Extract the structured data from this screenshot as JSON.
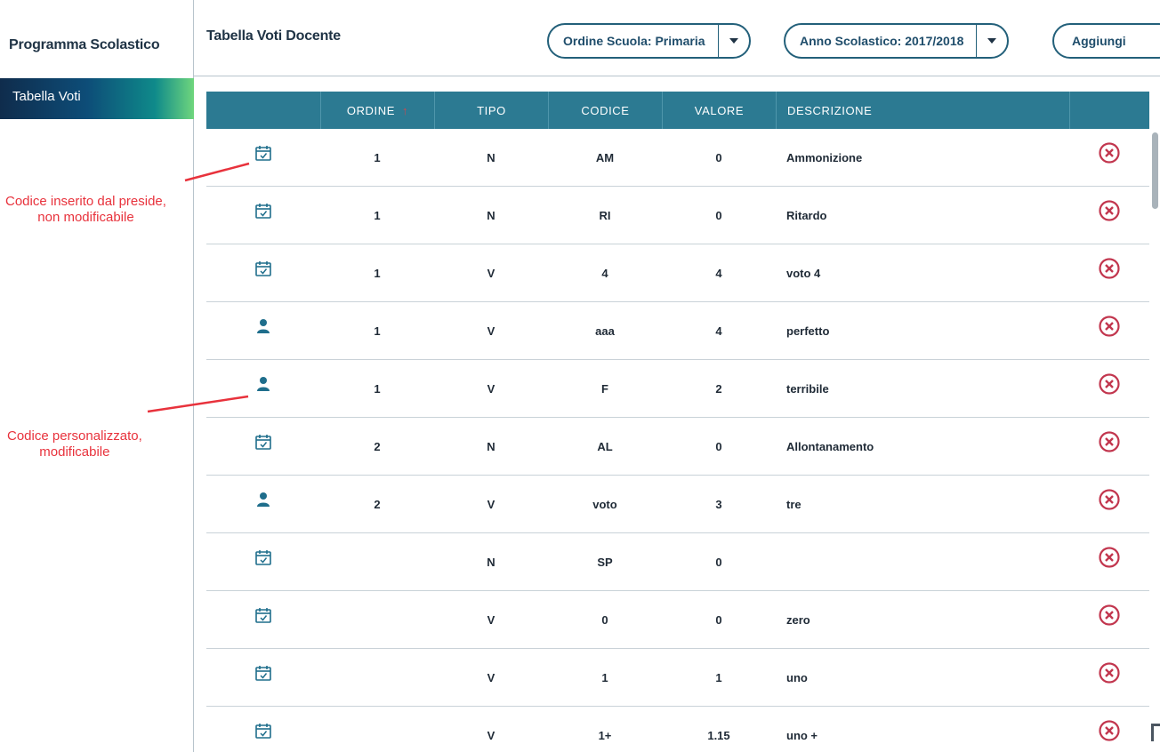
{
  "sidebar": {
    "title": "Programma Scolastico",
    "items": [
      {
        "label": "Tabella Voti"
      }
    ]
  },
  "header": {
    "title": "Tabella Voti Docente",
    "order_select": "Ordine Scuola: Primaria",
    "year_select": "Anno Scolastico: 2017/2018",
    "add_label": "Aggiungi"
  },
  "table": {
    "columns": [
      "",
      "ORDINE",
      "TIPO",
      "CODICE",
      "VALORE",
      "DESCRIZIONE",
      ""
    ],
    "sort_indicator": "↑",
    "rows": [
      {
        "icon": "calendar-check-icon",
        "ordine": "1",
        "tipo": "N",
        "codice": "AM",
        "valore": "0",
        "descrizione": "Ammonizione"
      },
      {
        "icon": "calendar-check-icon",
        "ordine": "1",
        "tipo": "N",
        "codice": "RI",
        "valore": "0",
        "descrizione": "Ritardo"
      },
      {
        "icon": "calendar-check-icon",
        "ordine": "1",
        "tipo": "V",
        "codice": "4",
        "valore": "4",
        "descrizione": "voto 4"
      },
      {
        "icon": "user-icon",
        "ordine": "1",
        "tipo": "V",
        "codice": "aaa",
        "valore": "4",
        "descrizione": "perfetto"
      },
      {
        "icon": "user-icon",
        "ordine": "1",
        "tipo": "V",
        "codice": "F",
        "valore": "2",
        "descrizione": "terribile"
      },
      {
        "icon": "calendar-check-icon",
        "ordine": "2",
        "tipo": "N",
        "codice": "AL",
        "valore": "0",
        "descrizione": "Allontanamento"
      },
      {
        "icon": "user-icon",
        "ordine": "2",
        "tipo": "V",
        "codice": "voto",
        "valore": "3",
        "descrizione": "tre"
      },
      {
        "icon": "calendar-check-icon",
        "ordine": "",
        "tipo": "N",
        "codice": "SP",
        "valore": "0",
        "descrizione": ""
      },
      {
        "icon": "calendar-check-icon",
        "ordine": "",
        "tipo": "V",
        "codice": "0",
        "valore": "0",
        "descrizione": "zero"
      },
      {
        "icon": "calendar-check-icon",
        "ordine": "",
        "tipo": "V",
        "codice": "1",
        "valore": "1",
        "descrizione": "uno"
      },
      {
        "icon": "calendar-check-icon",
        "ordine": "",
        "tipo": "V",
        "codice": "1+",
        "valore": "1.15",
        "descrizione": "uno +"
      }
    ]
  },
  "annotations": {
    "preside": [
      "Codice inserito dal preside,",
      "non modificabile"
    ],
    "personal": [
      "Codice personalizzato,",
      "modificabile"
    ]
  },
  "colors": {
    "accent": "#2c7a92",
    "delete": "#c2364e",
    "annotation": "#e8323c",
    "icon": "#1f6e8c"
  }
}
